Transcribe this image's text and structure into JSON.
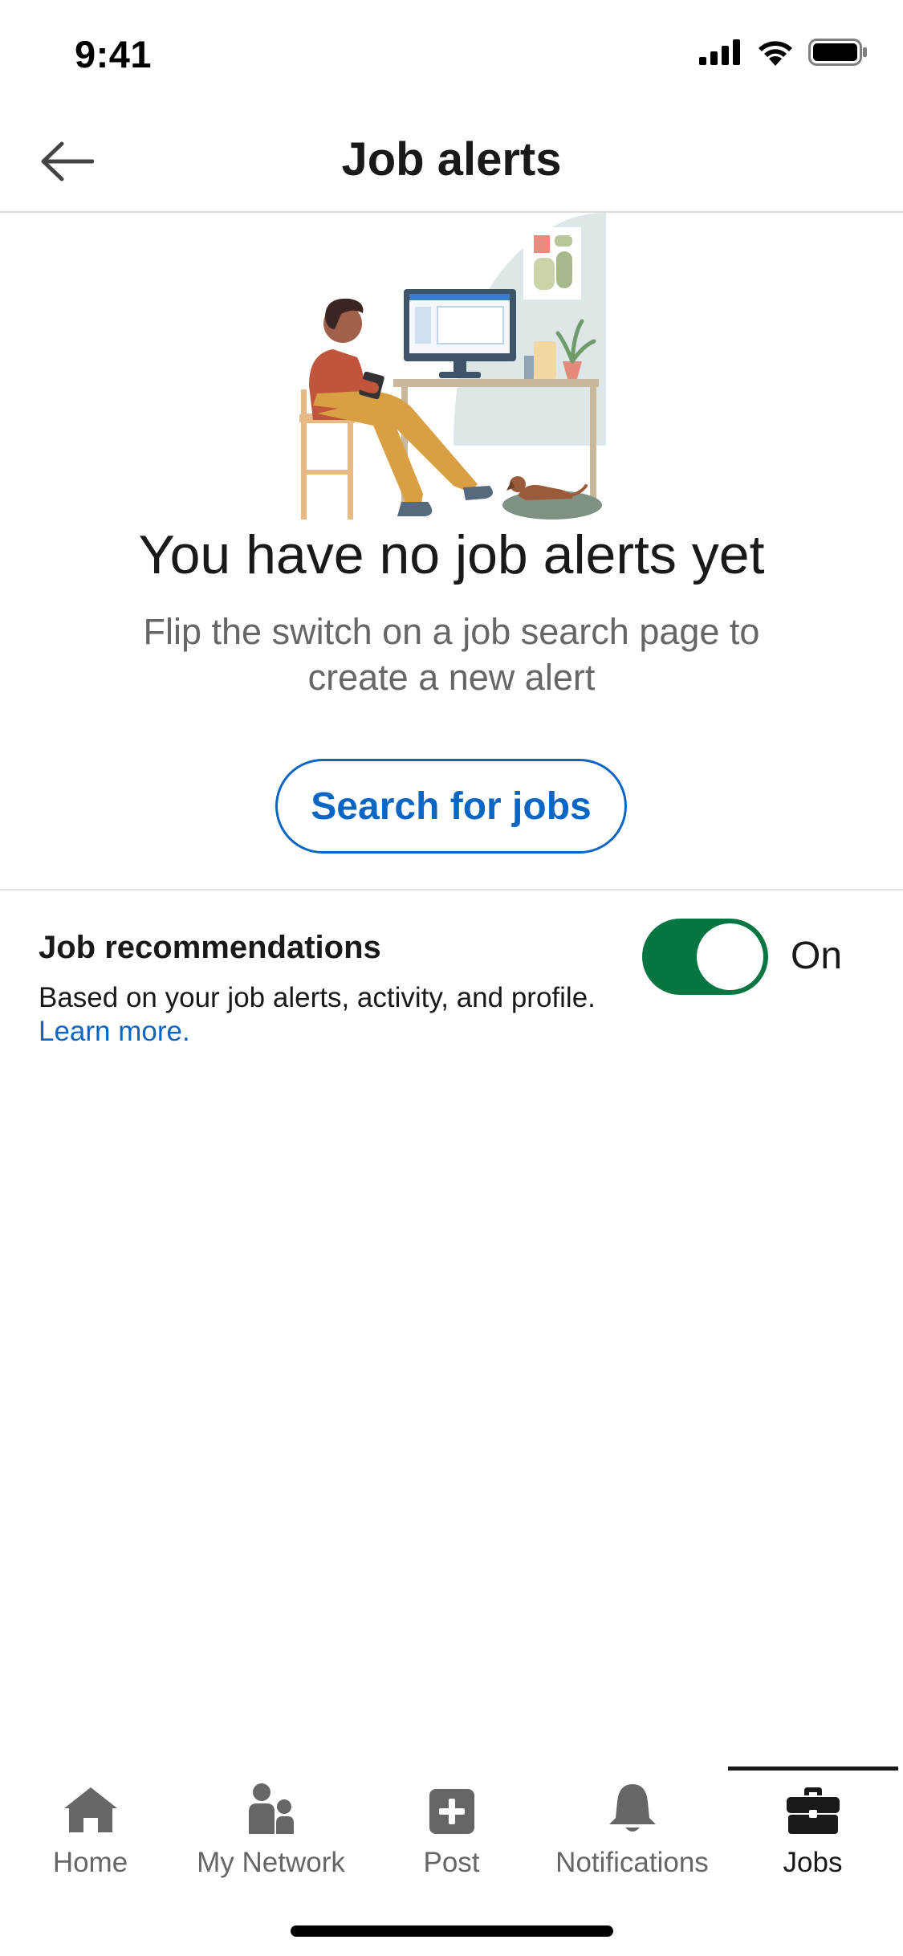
{
  "status_bar": {
    "time": "9:41",
    "icons": [
      "cellular-signal-icon",
      "wifi-icon",
      "battery-icon"
    ]
  },
  "header": {
    "title": "Job alerts",
    "back_icon": "arrow-left-icon"
  },
  "empty_state": {
    "title": "You have no job alerts yet",
    "subtitle": "Flip the switch on a job search page to create a new alert",
    "button_label": "Search for jobs"
  },
  "recommendations": {
    "title": "Job recommendations",
    "description": "Based on your job alerts, activity, and profile.",
    "link_text": "Learn more.",
    "toggle_on": true,
    "toggle_label": "On"
  },
  "bottom_nav": {
    "items": [
      {
        "label": "Home",
        "icon": "home-icon",
        "active": false
      },
      {
        "label": "My Network",
        "icon": "my-network-icon",
        "active": false
      },
      {
        "label": "Post",
        "icon": "post-icon",
        "active": false
      },
      {
        "label": "Notifications",
        "icon": "bell-icon",
        "active": false
      },
      {
        "label": "Jobs",
        "icon": "briefcase-icon",
        "active": true
      }
    ]
  },
  "colors": {
    "accent_blue": "#0a66c2",
    "toggle_green": "#057642",
    "text_primary": "#191919",
    "text_secondary": "#666666",
    "nav_icon_gray": "#666666"
  }
}
